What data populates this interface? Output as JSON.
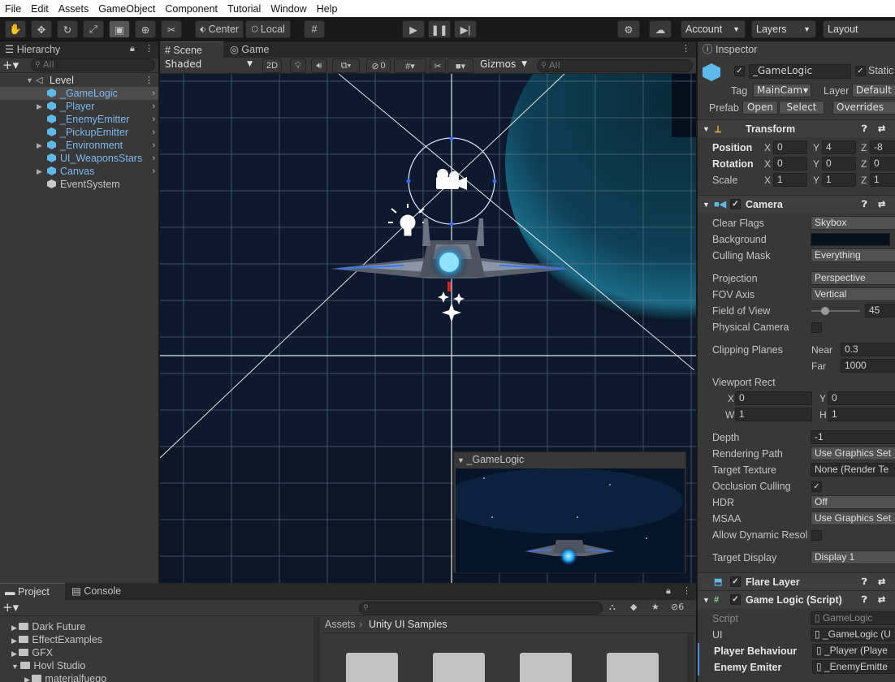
{
  "menu": [
    "File",
    "Edit",
    "Assets",
    "GameObject",
    "Component",
    "Tutorial",
    "Window",
    "Help"
  ],
  "toolbar": {
    "pivot": "Center",
    "space": "Local",
    "account": "Account",
    "layers": "Layers",
    "layout": "Layout"
  },
  "hierarchy": {
    "tab": "Hierarchy",
    "search_placeholder": "All",
    "scene": "Level",
    "items": [
      {
        "label": "_GameLogic",
        "prefab": true,
        "expandable": false,
        "selected": true
      },
      {
        "label": "_Player",
        "prefab": true,
        "expandable": true
      },
      {
        "label": "_EnemyEmitter",
        "prefab": true,
        "expandable": false
      },
      {
        "label": "_PickupEmitter",
        "prefab": true,
        "expandable": false
      },
      {
        "label": "_Environment",
        "prefab": true,
        "expandable": true
      },
      {
        "label": "UI_WeaponsStars",
        "prefab": true,
        "expandable": false
      },
      {
        "label": "Canvas",
        "prefab": true,
        "expandable": true
      },
      {
        "label": "EventSystem",
        "prefab": false,
        "expandable": false
      }
    ]
  },
  "scene_view": {
    "tabs": [
      "Scene",
      "Game"
    ],
    "shading": "Shaded",
    "mode_2d": "2D",
    "hidden_count": "0",
    "gizmos": "Gizmos",
    "search_placeholder": "All",
    "preview_title": "_GameLogic"
  },
  "inspector": {
    "tab": "Inspector",
    "object_name": "_GameLogic",
    "static": "Static",
    "tag_label": "Tag",
    "tag": "MainCam",
    "layer_label": "Layer",
    "layer": "Default",
    "prefab_label": "Prefab",
    "prefab_open": "Open",
    "prefab_select": "Select",
    "prefab_overrides": "Overrides",
    "transform": {
      "title": "Transform",
      "position": {
        "label": "Position",
        "x": "0",
        "y": "4",
        "z": "-8"
      },
      "rotation": {
        "label": "Rotation",
        "x": "0",
        "y": "0",
        "z": "0"
      },
      "scale": {
        "label": "Scale",
        "x": "1",
        "y": "1",
        "z": "1"
      }
    },
    "camera": {
      "title": "Camera",
      "clear_flags": {
        "label": "Clear Flags",
        "value": "Skybox"
      },
      "background": {
        "label": "Background",
        "color": "#05111c"
      },
      "culling_mask": {
        "label": "Culling Mask",
        "value": "Everything"
      },
      "projection": {
        "label": "Projection",
        "value": "Perspective"
      },
      "fov_axis": {
        "label": "FOV Axis",
        "value": "Vertical"
      },
      "field_of_view": {
        "label": "Field of View",
        "value": "45"
      },
      "physical_camera": {
        "label": "Physical Camera"
      },
      "clipping": {
        "label": "Clipping Planes",
        "near_label": "Near",
        "near": "0.3",
        "far_label": "Far",
        "far": "1000"
      },
      "viewport": {
        "label": "Viewport Rect",
        "x_label": "X",
        "x": "0",
        "y_label": "Y",
        "y": "0",
        "w_label": "W",
        "w": "1",
        "h_label": "H",
        "h": "1"
      },
      "depth": {
        "label": "Depth",
        "value": "-1"
      },
      "rendering_path": {
        "label": "Rendering Path",
        "value": "Use Graphics Set"
      },
      "target_texture": {
        "label": "Target Texture",
        "value": "None (Render Te"
      },
      "occlusion_culling": {
        "label": "Occlusion Culling"
      },
      "hdr": {
        "label": "HDR",
        "value": "Off"
      },
      "msaa": {
        "label": "MSAA",
        "value": "Use Graphics Set"
      },
      "allow_dynamic": {
        "label": "Allow Dynamic Resol"
      },
      "target_display": {
        "label": "Target Display",
        "value": "Display 1"
      }
    },
    "flare_layer": {
      "title": "Flare Layer"
    },
    "game_logic": {
      "title": "Game Logic (Script)",
      "script": {
        "label": "Script",
        "value": "GameLogic"
      },
      "ui": {
        "label": "UI",
        "value": "_GameLogic (U"
      },
      "player_behaviour": {
        "label": "Player Behaviour",
        "value": "_Player (Playe"
      },
      "enemy_emitter": {
        "label": "Enemy Emiter",
        "value": "_EnemyEmitte"
      }
    }
  },
  "project": {
    "tabs": [
      "Project",
      "Console"
    ],
    "hidden_count": "6",
    "tree": [
      "Dark Future",
      "EffectExamples",
      "GFX",
      "Hovl Studio",
      "materialfuego"
    ],
    "breadcrumb": [
      "Assets",
      "Unity UI Samples"
    ]
  },
  "colors": {
    "prefab_text": "#7eb8ef",
    "accent_blue": "#4c8fdc"
  }
}
